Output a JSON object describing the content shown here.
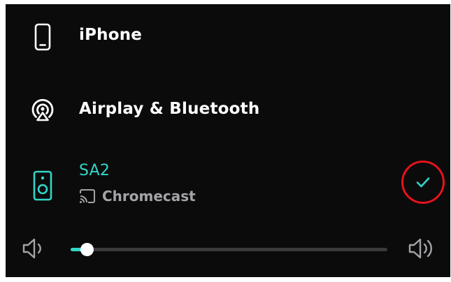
{
  "devices": [
    {
      "name": "iPhone",
      "icon": "phone-icon"
    },
    {
      "name": "Airplay & Bluetooth",
      "icon": "airplay-icon"
    },
    {
      "name": "SA2",
      "icon": "speaker-icon",
      "subtitle": "Chromecast",
      "subtitle_icon": "cast-icon",
      "selected": true,
      "selected_icon": "check-icon"
    }
  ],
  "volume": {
    "level": 0.05,
    "min_icon": "volume-low-icon",
    "max_icon": "volume-high-icon"
  },
  "colors": {
    "background": "#0b0b0c",
    "accent": "#33d6c8",
    "text": "#ffffff",
    "subtext": "#a3a4a8",
    "highlight_ring": "#e8121b",
    "track": "#3a3a3d"
  }
}
